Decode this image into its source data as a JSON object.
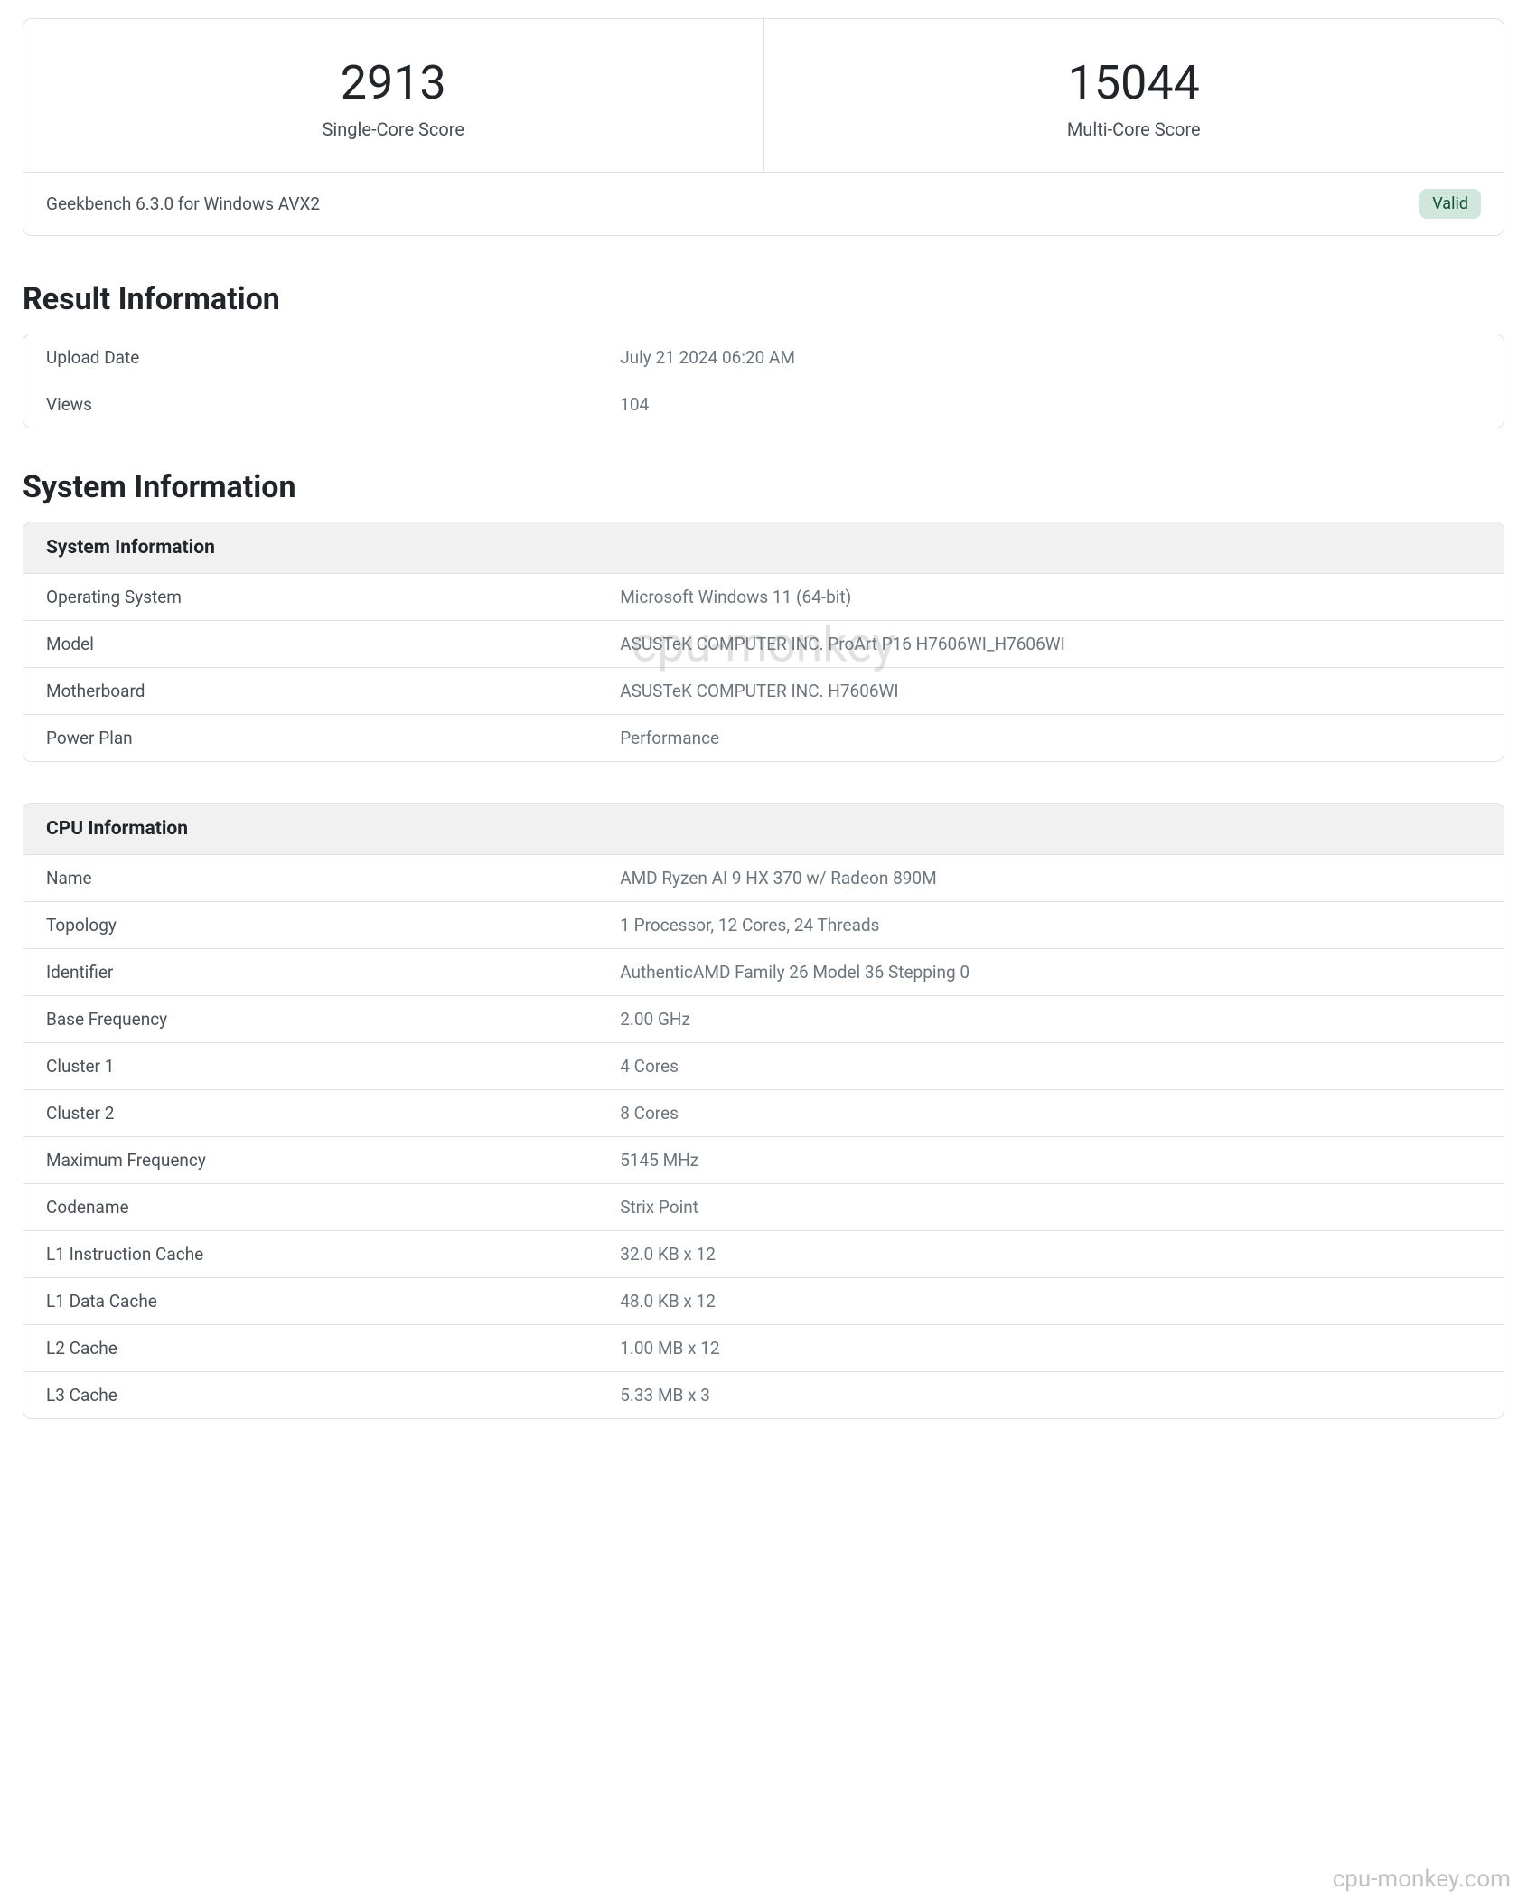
{
  "scores": {
    "single": {
      "value": "2913",
      "label": "Single-Core Score"
    },
    "multi": {
      "value": "15044",
      "label": "Multi-Core Score"
    }
  },
  "benchmark_name": "Geekbench 6.3.0 for Windows AVX2",
  "valid_badge": "Valid",
  "result_info_title": "Result Information",
  "result_info": [
    {
      "label": "Upload Date",
      "value": "July 21 2024 06:20 AM"
    },
    {
      "label": "Views",
      "value": "104"
    }
  ],
  "system_info_title": "System Information",
  "system_table_header": "System Information",
  "system_info": [
    {
      "label": "Operating System",
      "value": "Microsoft Windows 11 (64-bit)"
    },
    {
      "label": "Model",
      "value": "ASUSTeK COMPUTER INC. ProArt P16 H7606WI_H7606WI"
    },
    {
      "label": "Motherboard",
      "value": "ASUSTeK COMPUTER INC. H7606WI"
    },
    {
      "label": "Power Plan",
      "value": "Performance"
    }
  ],
  "cpu_table_header": "CPU Information",
  "cpu_info": [
    {
      "label": "Name",
      "value": "AMD Ryzen AI 9 HX 370 w/ Radeon 890M"
    },
    {
      "label": "Topology",
      "value": "1 Processor, 12 Cores, 24 Threads"
    },
    {
      "label": "Identifier",
      "value": "AuthenticAMD Family 26 Model 36 Stepping 0"
    },
    {
      "label": "Base Frequency",
      "value": "2.00 GHz"
    },
    {
      "label": "Cluster 1",
      "value": "4 Cores"
    },
    {
      "label": "Cluster 2",
      "value": "8 Cores"
    },
    {
      "label": "Maximum Frequency",
      "value": "5145 MHz"
    },
    {
      "label": "Codename",
      "value": "Strix Point"
    },
    {
      "label": "L1 Instruction Cache",
      "value": "32.0 KB x 12"
    },
    {
      "label": "L1 Data Cache",
      "value": "48.0 KB x 12"
    },
    {
      "label": "L2 Cache",
      "value": "1.00 MB x 12"
    },
    {
      "label": "L3 Cache",
      "value": "5.33 MB x 3"
    }
  ],
  "watermark_center": "cpu-monkey",
  "watermark_bottom": "cpu-monkey.com"
}
